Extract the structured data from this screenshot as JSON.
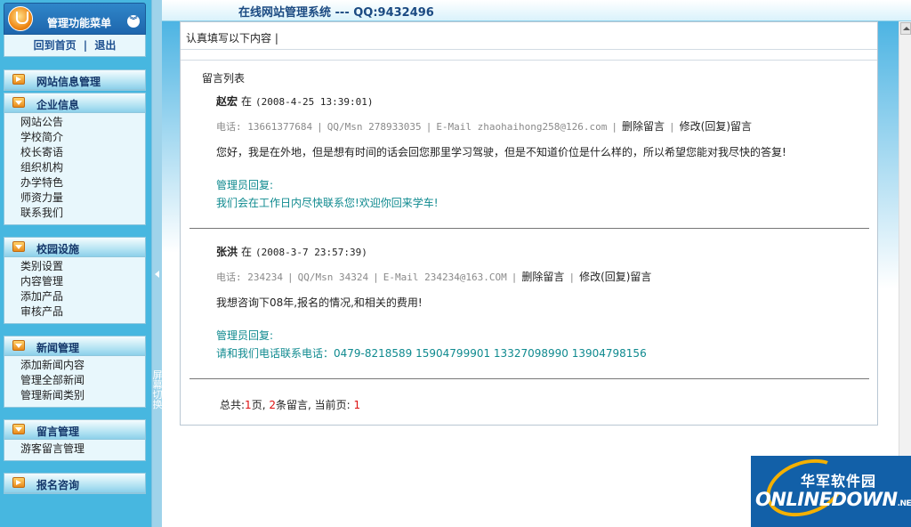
{
  "sidebar": {
    "menu_title": "管理功能菜单",
    "home_link": "回到首页",
    "separator": "|",
    "logout_link": "退出",
    "groups": [
      {
        "title": "网站信息管理",
        "items": []
      },
      {
        "title": "企业信息",
        "items": [
          "网站公告",
          "学校简介",
          "校长寄语",
          "组织机构",
          "办学特色",
          "师资力量",
          "联系我们"
        ]
      },
      {
        "title": "校园设施",
        "items": [
          "类别设置",
          "内容管理",
          "添加产品",
          "审核产品"
        ]
      },
      {
        "title": "新闻管理",
        "items": [
          "添加新闻内容",
          "管理全部新闻",
          "管理新闻类别"
        ]
      },
      {
        "title": "留言管理",
        "items": [
          "游客留言管理"
        ]
      },
      {
        "title": "报名咨询",
        "items": []
      }
    ]
  },
  "splitter": {
    "label": "屏幕切换"
  },
  "header": {
    "title": "在线网站管理系统 ---  QQ:9432496"
  },
  "main": {
    "instruction": "认真填写以下内容 |",
    "list_title": "留言列表",
    "messages": [
      {
        "name": "赵宏",
        "at": "在",
        "time": "(2008-4-25 13:39:01)",
        "phone": "电话: 13661377684",
        "qq": "QQ/Msn 278933035",
        "email": "E-Mail zhaohaihong258@126.com",
        "delete": "删除留言",
        "edit": "修改(回复)留言",
        "body": "您好，我是在外地，但是想有时间的话会回您那里学习驾驶，但是不知道价位是什么样的，所以希望您能对我尽快的答复!",
        "reply_label": "管理员回复:",
        "reply": "我们会在工作日内尽快联系您!欢迎你回来学车!"
      },
      {
        "name": "张洪",
        "at": "在",
        "time": "(2008-3-7 23:57:39)",
        "phone": "电话: 234234",
        "qq": "QQ/Msn 34324",
        "email": "E-Mail 234234@163.COM",
        "delete": "删除留言",
        "edit": "修改(回复)留言",
        "body": "我想咨询下08年,报名的情况,和相关的费用!",
        "reply_label": "管理员回复:",
        "reply": "请和我们电话联系电话：0479-8218589 15904799901 13327098990 13904798156"
      }
    ],
    "pagination": {
      "total_prefix": "总共:",
      "pages": "1",
      "pages_unit": "页,",
      "count": "2",
      "count_unit": "条留言,",
      "current_prefix": "当前页:",
      "current": "1"
    }
  },
  "watermark": {
    "cn": "华军软件园",
    "en": "ONLINEDOWN",
    "net": ".NET"
  },
  "colors": {
    "sidebar_bg": "#47b7e0",
    "header_text": "#1b4a82",
    "reply_text": "#0f8a8f",
    "page_number": "#dd1111"
  }
}
